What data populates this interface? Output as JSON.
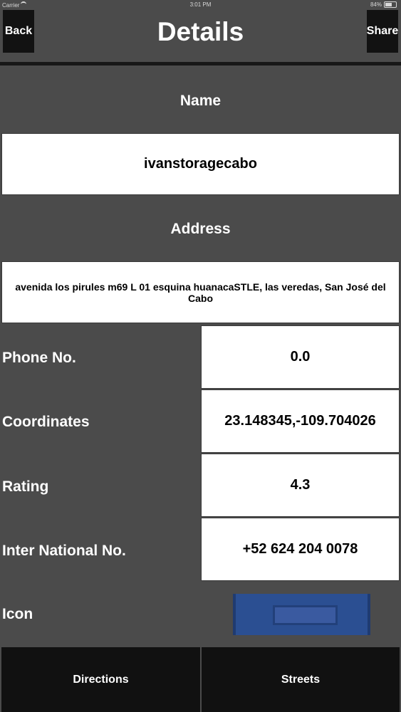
{
  "status_bar": {
    "carrier": "Carrier",
    "time": "3:01 PM",
    "battery": "84%"
  },
  "nav": {
    "back_label": "Back",
    "title": "Details",
    "share_label": "Share"
  },
  "name": {
    "label": "Name",
    "value": "ivanstoragecabo"
  },
  "address": {
    "label": "Address",
    "value": "avenida los pirules m69 L 01 esquina huanacaSTLE, las veredas, San José del Cabo"
  },
  "rows": [
    {
      "label": "Phone No.",
      "value": "0.0"
    },
    {
      "label": "Coordinates",
      "value": "23.148345,-109.704026"
    },
    {
      "label": "Rating",
      "value": "4.3"
    },
    {
      "label": "Inter National No.",
      "value": "+52 624 204 0078"
    }
  ],
  "icon_row": {
    "label": "Icon"
  },
  "bottom": {
    "directions_label": "Directions",
    "streets_label": "Streets"
  },
  "colors": {
    "background": "#4b4b4b",
    "button": "#111111",
    "icon_blue": "#2b4f92"
  }
}
